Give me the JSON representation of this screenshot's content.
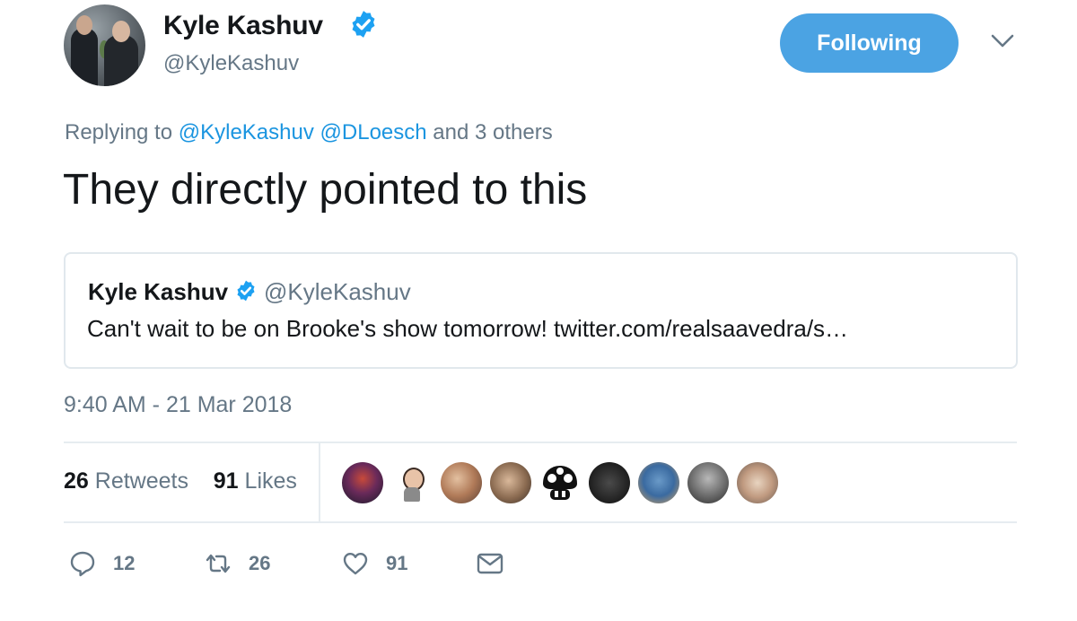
{
  "author": {
    "name": "Kyle Kashuv",
    "handle": "@KyleKashuv"
  },
  "follow_button": {
    "label": "Following"
  },
  "reply_context": {
    "prefix": "Replying to",
    "mention_1": "@KyleKashuv",
    "mention_2": "@DLoesch",
    "suffix": "and 3 others"
  },
  "tweet": {
    "text": "They directly pointed to this",
    "timestamp": "9:40 AM - 21 Mar 2018"
  },
  "quoted_tweet": {
    "name": "Kyle Kashuv",
    "handle": "@KyleKashuv",
    "text": "Can't wait to be on Brooke's show tomorrow! twitter.com/realsaavedra/s…"
  },
  "stats": {
    "retweets_count": "26",
    "retweets_label": "Retweets",
    "likes_count": "91",
    "likes_label": "Likes"
  },
  "actions": {
    "reply_count": "12",
    "retweet_count": "26",
    "like_count": "91"
  },
  "colors": {
    "accent": "#1b95e0",
    "follow_button": "#4ba3e3",
    "secondary_text": "#657786",
    "divider": "#e6ecf0"
  },
  "icons": [
    "verified-badge-icon",
    "chevron-down-icon",
    "reply-icon",
    "retweet-icon",
    "heart-icon",
    "envelope-icon"
  ]
}
